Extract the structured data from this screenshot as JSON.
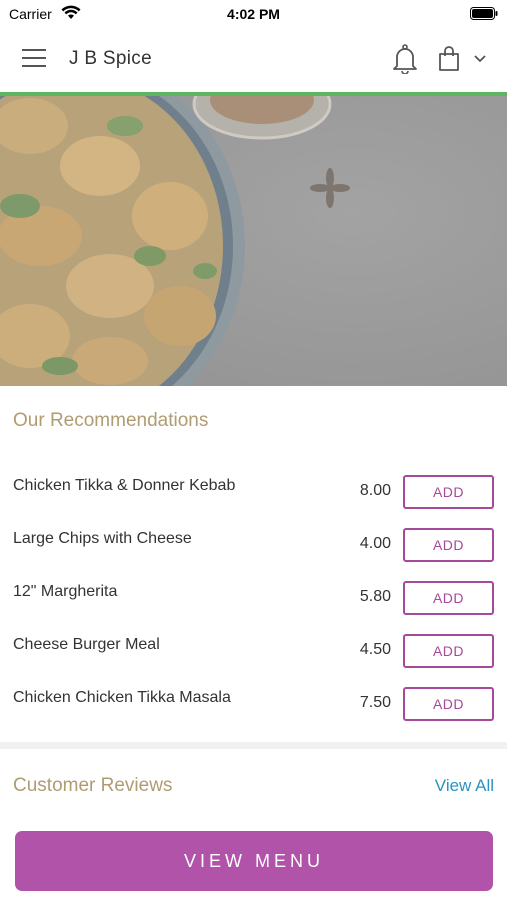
{
  "status_bar": {
    "carrier": "Carrier",
    "time": "4:02 PM"
  },
  "header": {
    "title": "J B Spice",
    "icons": [
      "menu-icon",
      "bell-icon",
      "shopping-bag-icon",
      "chevron-down-icon"
    ]
  },
  "colors": {
    "accent": "#b153a9",
    "add_border": "#a6499c",
    "section_title": "#b09c72",
    "link": "#2c93bd",
    "header_underline": "#5db65f"
  },
  "recommendations": {
    "title": "Our Recommendations",
    "items": [
      {
        "name": "Chicken Tikka & Donner Kebab",
        "price": "8.00",
        "action": "ADD"
      },
      {
        "name": "Large Chips with Cheese",
        "price": "4.00",
        "action": "ADD"
      },
      {
        "name": "12\" Margherita",
        "price": "5.80",
        "action": "ADD"
      },
      {
        "name": "Cheese Burger Meal",
        "price": "4.50",
        "action": "ADD"
      },
      {
        "name": "Chicken Chicken Tikka Masala",
        "price": "7.50",
        "action": "ADD"
      }
    ]
  },
  "reviews": {
    "title": "Customer Reviews",
    "view_all": "View All"
  },
  "footer": {
    "button": "VIEW MENU"
  }
}
